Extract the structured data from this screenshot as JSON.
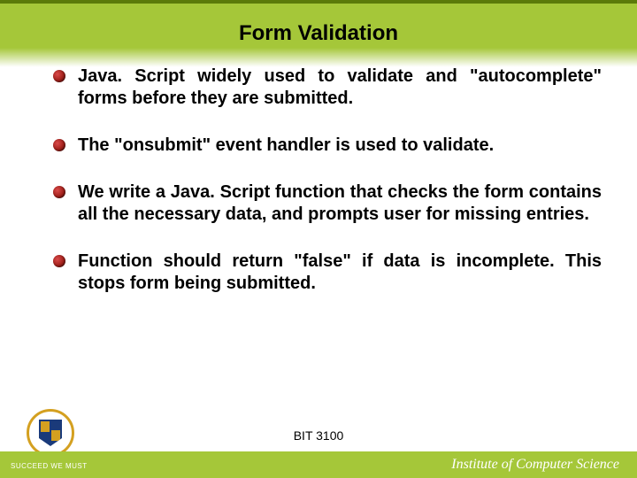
{
  "slide": {
    "title": "Form Validation",
    "bullets": [
      "Java. Script widely used to validate and \"autocomplete\" forms before they are submitted.",
      "The \"onsubmit\" event handler is used to validate.",
      "We write a Java. Script function that checks the form contains all the necessary data, and prompts user for missing entries.",
      "Function should return \"false\" if data is incomplete. This stops form being submitted."
    ],
    "course_code": "BIT 3100",
    "footer_institute": "Institute of Computer Science",
    "motto": "SUCCEED WE MUST"
  }
}
